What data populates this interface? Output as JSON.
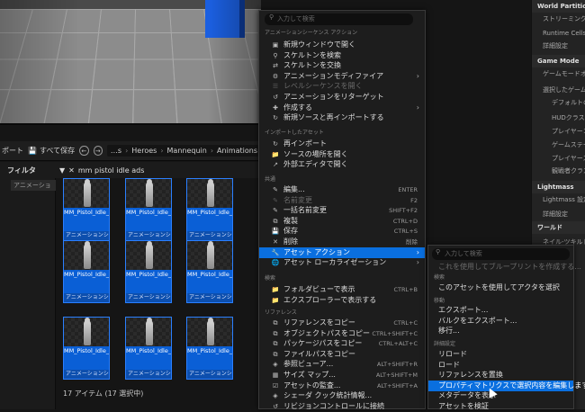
{
  "content_browser": {
    "toolbar": {
      "import_partial": "ポート",
      "save_all": "すべて保存",
      "crumbs": [
        "…s",
        "Heroes",
        "Mannequin",
        "Animations"
      ]
    },
    "filters_label": "フィルタ",
    "search_value": "mm pistol idle ads",
    "filter_chip": "アニメーション",
    "assets": [
      {
        "name": "MM_Pistol_Idle_ADS_AO_LBC",
        "type": "アニメーションシー"
      },
      {
        "name": "MM_Pistol_Idle_ADS_AO_CD...",
        "type": "アニメーションシー"
      },
      {
        "name": "MM_Pistol_Idle_ADS_AO_CD...",
        "type": "アニメーションシー"
      },
      {
        "name": "MM_Pistol_Idle_ADS_AO_LBD",
        "type": "アニメーションシー"
      },
      {
        "name": "MM_Pistol_Idle_ADS_AO_LBO",
        "type": "アニメーションシー"
      },
      {
        "name": "MM_Pistol_Idle_ADS_AO_LBU",
        "type": "アニメーションシー"
      },
      {
        "name": "MM_Pistol_Idle_ADS_AO_LU",
        "type": "アニメーションシー"
      },
      {
        "name": "MM_Pistol_Idle_ADS_AO_RBC",
        "type": "アニメーションシー"
      },
      {
        "name": "MM_Pistol_Idle_ADS_AO_RBD",
        "type": "アニメーションシー"
      }
    ],
    "status": "17 アイテム (17 選択中)"
  },
  "right_panel": [
    {
      "label": "World Partition",
      "kind": "head"
    },
    {
      "label": "ストリーミングを",
      "kind": "sub"
    },
    {
      "label": "Runtime Cells",
      "kind": "sub"
    },
    {
      "label": "詳細設定",
      "kind": "sub"
    },
    {
      "label": "Game Mode",
      "kind": "head"
    },
    {
      "label": "ゲームモードオー",
      "kind": "sub"
    },
    {
      "label": "選択したゲーム",
      "kind": "sub"
    },
    {
      "label": "デフォルトの",
      "kind": "sub2"
    },
    {
      "label": "HUDクラス",
      "kind": "sub2"
    },
    {
      "label": "プレイヤーコ",
      "kind": "sub2"
    },
    {
      "label": "ゲームステー",
      "kind": "sub2"
    },
    {
      "label": "プレイヤース",
      "kind": "sub2"
    },
    {
      "label": "観戦者クラス",
      "kind": "sub2"
    },
    {
      "label": "Lightmass",
      "kind": "head"
    },
    {
      "label": "Lightmass 設定",
      "kind": "sub"
    },
    {
      "label": "詳細設定",
      "kind": "sub"
    },
    {
      "label": "ワールド",
      "kind": "head"
    },
    {
      "label": "ネイル-ツキルド",
      "kind": "sub"
    }
  ],
  "context_menu": {
    "search_placeholder": "入力して検索",
    "sections": [
      {
        "label": "アニメーションシーケンス アクション",
        "items": [
          {
            "label": "新規ウィンドウで開く",
            "icon": "window-icon"
          },
          {
            "label": "スケルトンを検索",
            "icon": "search-icon"
          },
          {
            "label": "スケルトンを交換",
            "icon": "swap-icon"
          },
          {
            "label": "アニメーションモディファイア",
            "icon": "modifier-icon",
            "submenu": true
          },
          {
            "label": "レベルシーケンスを開く",
            "icon": "sequence-icon",
            "disabled": true
          },
          {
            "label": "アニメーションをリターゲット",
            "icon": "retarget-icon"
          },
          {
            "label": "作成する",
            "icon": "create-icon",
            "submenu": true
          },
          {
            "label": "新規ソースと再インポートする",
            "icon": "reimport-icon"
          }
        ]
      },
      {
        "label": "インポートしたアセット",
        "items": [
          {
            "label": "再インポート",
            "icon": "reimport-icon"
          },
          {
            "label": "ソースの場所を開く",
            "icon": "folder-icon"
          },
          {
            "label": "外部エディタで開く",
            "icon": "external-icon"
          }
        ]
      },
      {
        "label": "共通",
        "items": [
          {
            "label": "編集...",
            "icon": "edit-icon",
            "shortcut": "ENTER"
          },
          {
            "label": "名前変更",
            "icon": "rename-icon",
            "shortcut": "F2",
            "disabled": true
          },
          {
            "label": "一括名前変更",
            "icon": "rename-icon",
            "shortcut": "SHIFT+F2"
          },
          {
            "label": "複製",
            "icon": "duplicate-icon",
            "shortcut": "CTRL+D"
          },
          {
            "label": "保存",
            "icon": "save-icon",
            "shortcut": "CTRL+S"
          },
          {
            "label": "削除",
            "icon": "delete-icon",
            "shortcut": "削除"
          },
          {
            "label": "アセット アクション",
            "icon": "wrench-icon",
            "submenu": true,
            "highlighted": true
          },
          {
            "label": "アセット ローカライゼーション",
            "icon": "globe-icon",
            "submenu": true
          }
        ]
      },
      {
        "label": "検索",
        "items": [
          {
            "label": "フォルダビューで表示",
            "icon": "folder-icon",
            "shortcut": "CTRL+B"
          },
          {
            "label": "エクスプローラーで表示する",
            "icon": "explorer-icon"
          }
        ]
      },
      {
        "label": "リファレンス",
        "items": [
          {
            "label": "リファレンスをコピー",
            "icon": "copy-icon",
            "shortcut": "CTRL+C"
          },
          {
            "label": "オブジェクトパスをコピー",
            "icon": "copy-icon",
            "shortcut": "CTRL+SHIFT+C"
          },
          {
            "label": "パッケージパスをコピー",
            "icon": "copy-icon",
            "shortcut": "CTRL+ALT+C"
          },
          {
            "label": "ファイルパスをコピー",
            "icon": "copy-icon"
          },
          {
            "label": "参照ビューア...",
            "icon": "reference-icon",
            "shortcut": "ALT+SHIFT+R"
          },
          {
            "label": "サイズ マップ...",
            "icon": "sizemap-icon",
            "shortcut": "ALT+SHIFT+M"
          },
          {
            "label": "アセットの監査...",
            "icon": "audit-icon",
            "shortcut": "ALT+SHIFT+A"
          },
          {
            "label": "シェーダ クック統計情報...",
            "icon": "shader-icon"
          },
          {
            "label": "リビジョンコントロールに接続",
            "icon": "vcs-icon"
          }
        ]
      }
    ]
  },
  "submenu": {
    "search_placeholder": "入力して検索",
    "sections": [
      {
        "label": "",
        "items": [
          {
            "label": "これを使用してブループリントを作成する...",
            "disabled": true
          }
        ]
      },
      {
        "label": "検索",
        "items": [
          {
            "label": "このアセットを使用してアクタを選択"
          }
        ]
      },
      {
        "label": "移動",
        "items": [
          {
            "label": "エクスポート..."
          },
          {
            "label": "バルクをエクスポート..."
          },
          {
            "label": "移行..."
          }
        ]
      },
      {
        "label": "詳細設定",
        "items": [
          {
            "label": "リロード"
          },
          {
            "label": "ロード"
          },
          {
            "label": "リファレンスを置換"
          },
          {
            "label": "プロパティマトリクスで選択内容を編集します",
            "highlighted": true
          },
          {
            "label": "メタデータを表示"
          },
          {
            "label": "アセットを検証"
          }
        ]
      }
    ]
  },
  "colors": {
    "accent": "#0a6fdf",
    "tile_selected": "#0a5fd6",
    "cube": "#1b5fe0"
  }
}
